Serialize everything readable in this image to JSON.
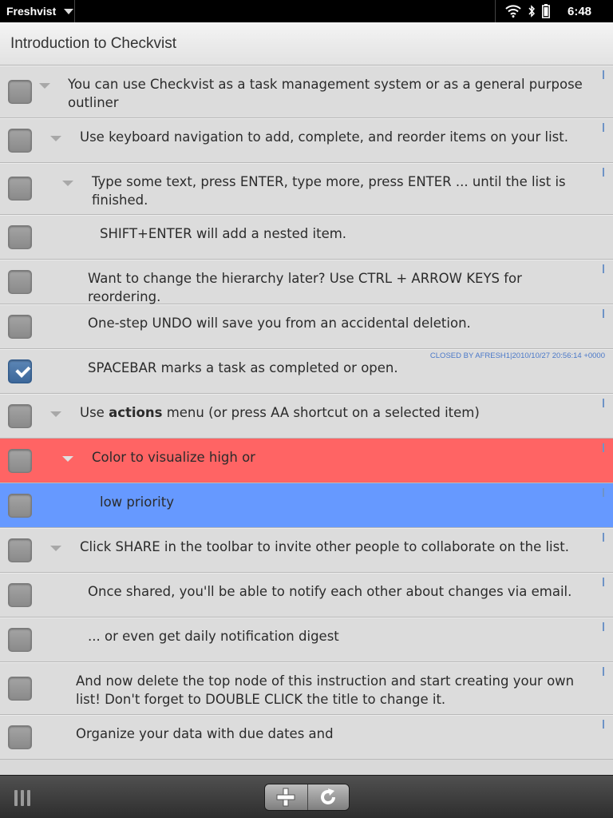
{
  "statusbar": {
    "app_name": "Freshvist",
    "time": "6:48"
  },
  "header": {
    "title": "Introduction to Checkvist"
  },
  "items": [
    {
      "text": "You can use Checkvist as a task management system or as a general purpose outliner"
    },
    {
      "text": "Use keyboard navigation to add, complete, and reorder items on your list."
    },
    {
      "text": "Type some text, press ENTER, type more, press ENTER ... until the list is finished."
    },
    {
      "text": "SHIFT+ENTER will add a nested item."
    },
    {
      "text": "Want to change the hierarchy later? Use CTRL + ARROW KEYS for reordering."
    },
    {
      "text": "One-step UNDO will save you from an accidental deletion."
    },
    {
      "text": "SPACEBAR marks a task as completed or open.",
      "closed_note": "CLOSED BY AFRESH1|2010/10/27 20:56:14 +0000"
    },
    {
      "text_before": "Use ",
      "text_bold": "actions",
      "text_after": " menu (or press AA shortcut on a selected item)"
    },
    {
      "text": "Color to visualize high or"
    },
    {
      "text": "low priority"
    },
    {
      "text": "Click SHARE in the toolbar to invite other people to collaborate on the list."
    },
    {
      "text": "Once shared, you'll be able to notify each other about changes via email."
    },
    {
      "text": "... or even get daily notification digest"
    },
    {
      "text": "And now delete the top node of this instruction and start creating your own list! Don't forget to DOUBLE CLICK the title to change it."
    },
    {
      "text": "Organize your data with due dates and"
    }
  ],
  "colors": {
    "high_priority": "#ff6464",
    "low_priority": "#6699ff",
    "accent": "#4a78c8"
  },
  "toolbar": {
    "add_icon": "plus-icon",
    "refresh_icon": "refresh-icon",
    "menu_icon": "grip-icon"
  }
}
